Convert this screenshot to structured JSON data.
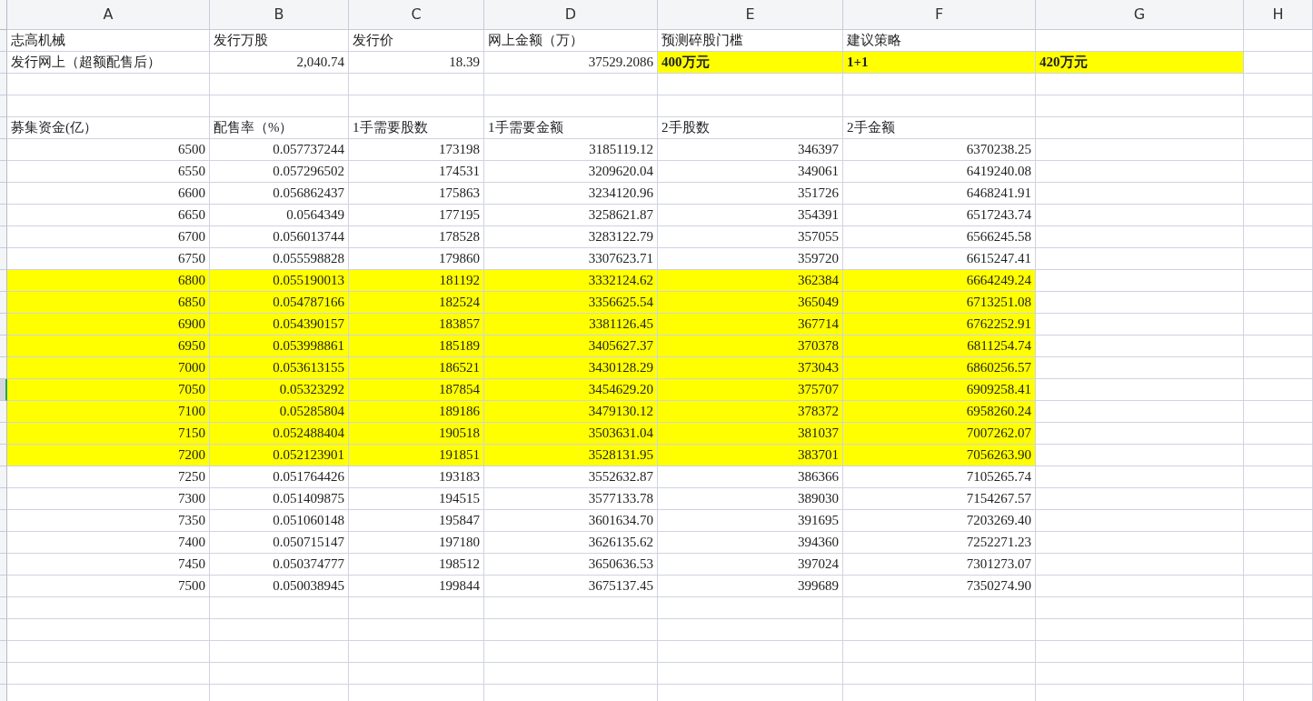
{
  "columns": [
    "A",
    "B",
    "C",
    "D",
    "E",
    "F",
    "G",
    "H"
  ],
  "top_rows": [
    [
      {
        "text": "志高机械",
        "kind": "label",
        "bold": false,
        "highlighted": false
      },
      {
        "text": "发行万股",
        "kind": "label",
        "bold": false,
        "highlighted": false
      },
      {
        "text": "发行价",
        "kind": "label",
        "bold": false,
        "highlighted": false
      },
      {
        "text": "网上金额（万）",
        "kind": "label",
        "bold": false,
        "highlighted": false
      },
      {
        "text": "预测碎股门槛",
        "kind": "label",
        "bold": false,
        "highlighted": false
      },
      {
        "text": "建议策略",
        "kind": "label",
        "bold": false,
        "highlighted": false
      }
    ],
    [
      {
        "text": "发行网上（超额配售后）",
        "kind": "label",
        "bold": false,
        "highlighted": false
      },
      {
        "text": "2,040.74",
        "kind": "number",
        "bold": false,
        "highlighted": false
      },
      {
        "text": "18.39",
        "kind": "number",
        "bold": false,
        "highlighted": false
      },
      {
        "text": "37529.2086",
        "kind": "number",
        "bold": false,
        "highlighted": false
      },
      {
        "text": "400万元",
        "kind": "label",
        "bold": true,
        "highlighted": true
      },
      {
        "text": "1+1",
        "kind": "label",
        "bold": true,
        "highlighted": true
      },
      {
        "text": "420万元",
        "kind": "label",
        "bold": true,
        "highlighted": true
      }
    ],
    [],
    [],
    [
      {
        "text": "募集资金(亿）",
        "kind": "label",
        "bold": false,
        "highlighted": false
      },
      {
        "text": "配售率（%）",
        "kind": "label",
        "bold": false,
        "highlighted": false
      },
      {
        "text": "1手需要股数",
        "kind": "label",
        "bold": false,
        "highlighted": false
      },
      {
        "text": "1手需要金额",
        "kind": "label",
        "bold": false,
        "highlighted": false
      },
      {
        "text": "2手股数",
        "kind": "label",
        "bold": false,
        "highlighted": false
      },
      {
        "text": "2手金额",
        "kind": "label",
        "bold": false,
        "highlighted": false
      }
    ]
  ],
  "data_rows": [
    {
      "values": [
        "6500",
        "0.057737244",
        "173198",
        "3185119.12",
        "346397",
        "6370238.25"
      ],
      "highlighted": false,
      "active": false
    },
    {
      "values": [
        "6550",
        "0.057296502",
        "174531",
        "3209620.04",
        "349061",
        "6419240.08"
      ],
      "highlighted": false,
      "active": false
    },
    {
      "values": [
        "6600",
        "0.056862437",
        "175863",
        "3234120.96",
        "351726",
        "6468241.91"
      ],
      "highlighted": false,
      "active": false
    },
    {
      "values": [
        "6650",
        "0.0564349",
        "177195",
        "3258621.87",
        "354391",
        "6517243.74"
      ],
      "highlighted": false,
      "active": false
    },
    {
      "values": [
        "6700",
        "0.056013744",
        "178528",
        "3283122.79",
        "357055",
        "6566245.58"
      ],
      "highlighted": false,
      "active": false
    },
    {
      "values": [
        "6750",
        "0.055598828",
        "179860",
        "3307623.71",
        "359720",
        "6615247.41"
      ],
      "highlighted": false,
      "active": false
    },
    {
      "values": [
        "6800",
        "0.055190013",
        "181192",
        "3332124.62",
        "362384",
        "6664249.24"
      ],
      "highlighted": true,
      "active": false
    },
    {
      "values": [
        "6850",
        "0.054787166",
        "182524",
        "3356625.54",
        "365049",
        "6713251.08"
      ],
      "highlighted": true,
      "active": false
    },
    {
      "values": [
        "6900",
        "0.054390157",
        "183857",
        "3381126.45",
        "367714",
        "6762252.91"
      ],
      "highlighted": true,
      "active": false
    },
    {
      "values": [
        "6950",
        "0.053998861",
        "185189",
        "3405627.37",
        "370378",
        "6811254.74"
      ],
      "highlighted": true,
      "active": false
    },
    {
      "values": [
        "7000",
        "0.053613155",
        "186521",
        "3430128.29",
        "373043",
        "6860256.57"
      ],
      "highlighted": true,
      "active": false
    },
    {
      "values": [
        "7050",
        "0.05323292",
        "187854",
        "3454629.20",
        "375707",
        "6909258.41"
      ],
      "highlighted": true,
      "active": true
    },
    {
      "values": [
        "7100",
        "0.05285804",
        "189186",
        "3479130.12",
        "378372",
        "6958260.24"
      ],
      "highlighted": true,
      "active": false
    },
    {
      "values": [
        "7150",
        "0.052488404",
        "190518",
        "3503631.04",
        "381037",
        "7007262.07"
      ],
      "highlighted": true,
      "active": false
    },
    {
      "values": [
        "7200",
        "0.052123901",
        "191851",
        "3528131.95",
        "383701",
        "7056263.90"
      ],
      "highlighted": true,
      "active": false
    },
    {
      "values": [
        "7250",
        "0.051764426",
        "193183",
        "3552632.87",
        "386366",
        "7105265.74"
      ],
      "highlighted": false,
      "active": false
    },
    {
      "values": [
        "7300",
        "0.051409875",
        "194515",
        "3577133.78",
        "389030",
        "7154267.57"
      ],
      "highlighted": false,
      "active": false
    },
    {
      "values": [
        "7350",
        "0.051060148",
        "195847",
        "3601634.70",
        "391695",
        "7203269.40"
      ],
      "highlighted": false,
      "active": false
    },
    {
      "values": [
        "7400",
        "0.050715147",
        "197180",
        "3626135.62",
        "394360",
        "7252271.23"
      ],
      "highlighted": false,
      "active": false
    },
    {
      "values": [
        "7450",
        "0.050374777",
        "198512",
        "3650636.53",
        "397024",
        "7301273.07"
      ],
      "highlighted": false,
      "active": false
    },
    {
      "values": [
        "7500",
        "0.050038945",
        "199844",
        "3675137.45",
        "399689",
        "7350274.90"
      ],
      "highlighted": false,
      "active": false
    }
  ]
}
